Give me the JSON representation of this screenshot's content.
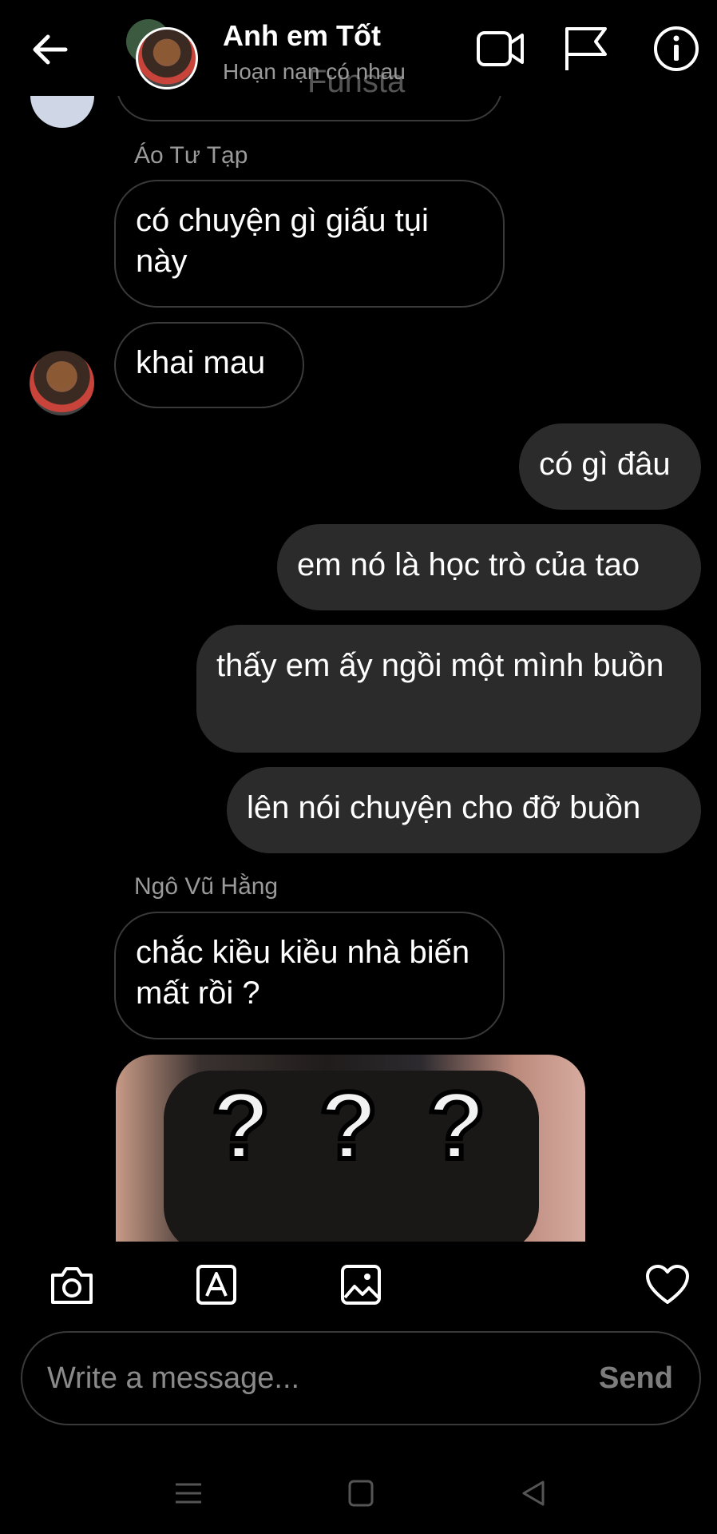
{
  "header": {
    "title": "Anh em Tốt",
    "subtitle": "Hoạn nạn có nhau",
    "ghost_text": "Funsta"
  },
  "messages": [
    {
      "sender": "Áo Tư Tạp",
      "text": "có chuyện gì giấu tụi này"
    },
    {
      "text": "khai mau"
    },
    {
      "text": "có gì đâu"
    },
    {
      "text": "em nó là học trò của tao"
    },
    {
      "text": "thấy em ấy ngồi một mình buồn"
    },
    {
      "text": "lên nói chuyện cho đỡ buồn"
    },
    {
      "sender": "Ngô Vũ Hằng",
      "text": "chắc kiều kiều nhà biến mất  rồi ?"
    }
  ],
  "image_message": {
    "marks": [
      "?",
      "?",
      "?"
    ]
  },
  "composer": {
    "placeholder": "Write a message...",
    "send_label": "Send"
  },
  "colors": {
    "background": "#000000",
    "outgoing_bubble": "#2b2b2b",
    "incoming_border": "#3a3a3a",
    "muted_text": "#9a9a9a"
  }
}
